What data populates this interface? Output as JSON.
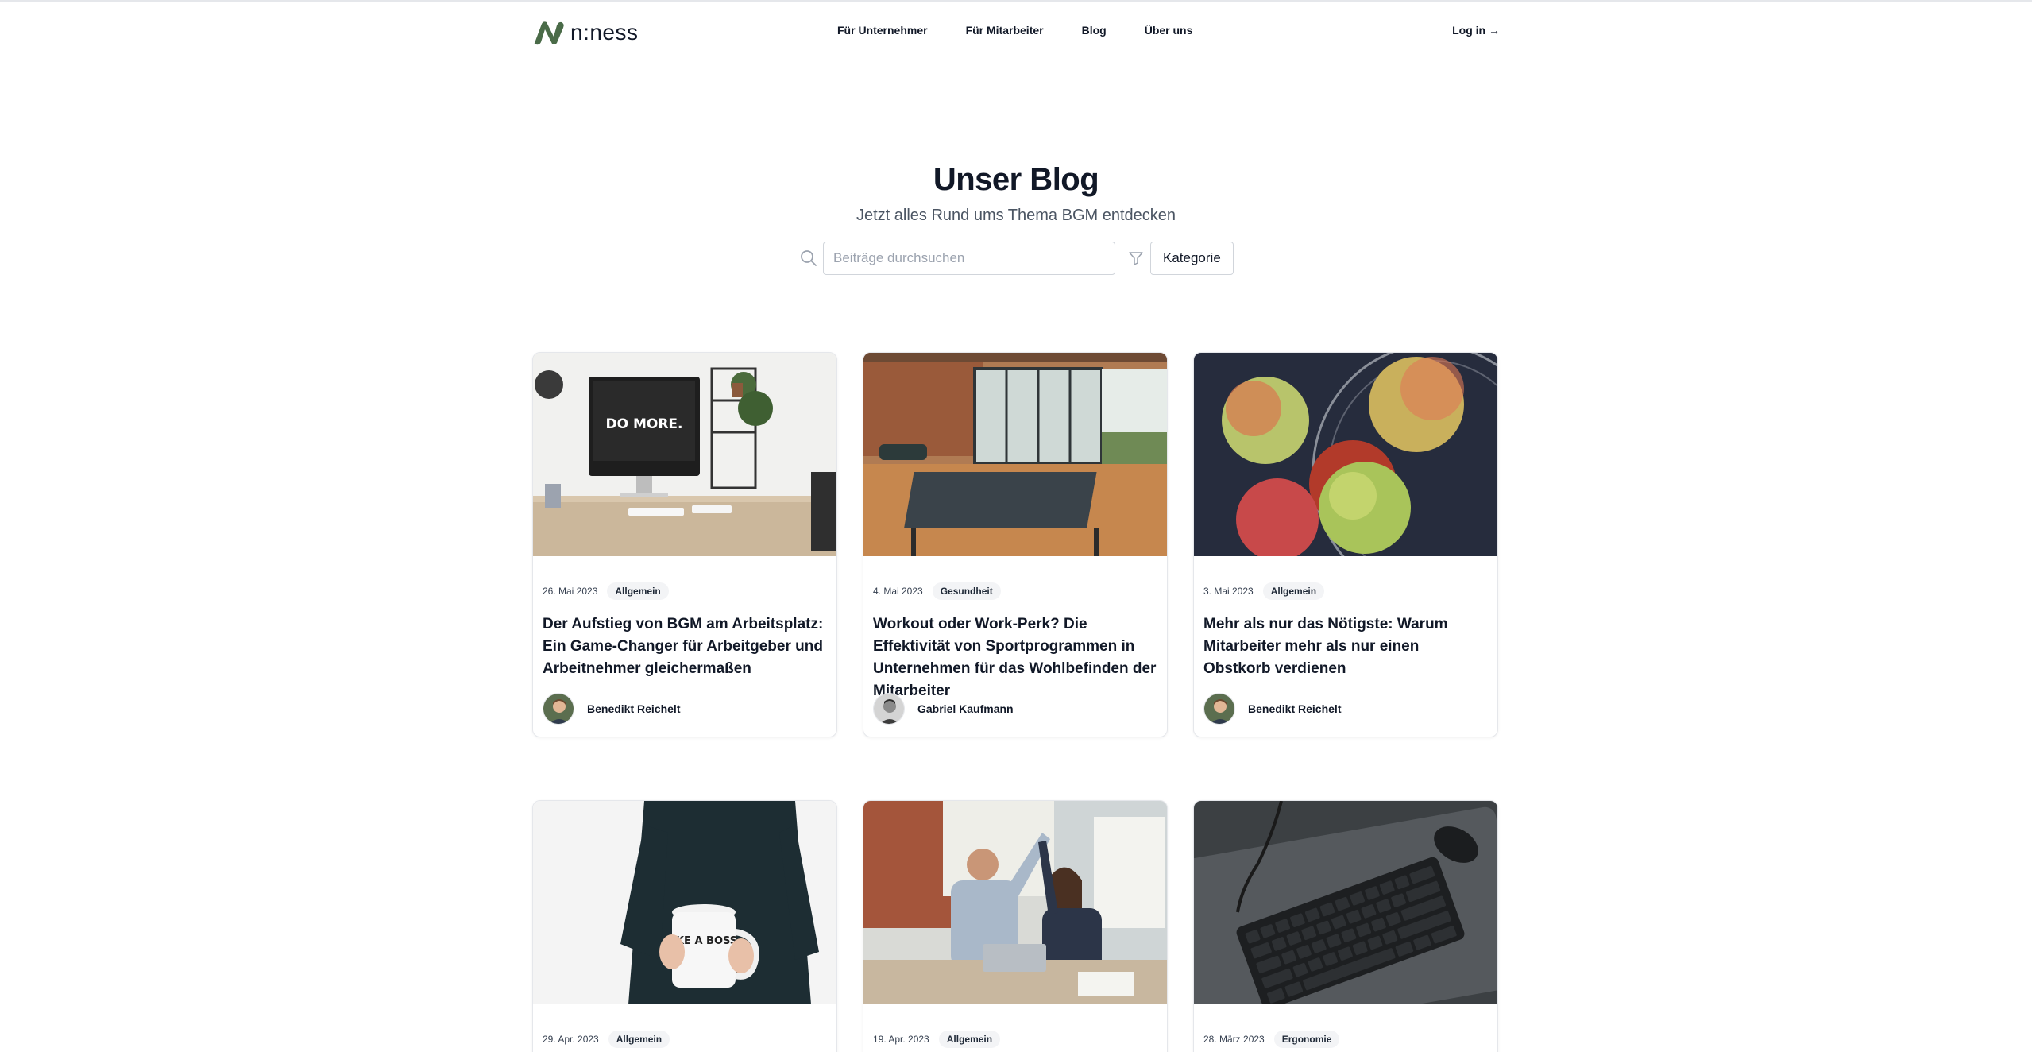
{
  "header": {
    "logo_text": "n:ness",
    "nav": [
      "Für Unternehmer",
      "Für Mitarbeiter",
      "Blog",
      "Über uns"
    ],
    "login": "Log in →"
  },
  "hero": {
    "title": "Unser Blog",
    "subtitle": "Jetzt alles Rund ums Thema BGM entdecken",
    "search_placeholder": "Beiträge durchsuchen",
    "category_button": "Kategorie"
  },
  "posts": [
    {
      "date": "26. Mai 2023",
      "category": "Allgemein",
      "title": "Der Aufstieg von BGM am Arbeitsplatz: Ein Game-Changer für Arbeitgeber und Arbeitnehmer gleichermaßen",
      "author": "Benedikt Reichelt",
      "image_text": "DO MORE."
    },
    {
      "date": "4. Mai 2023",
      "category": "Gesundheit",
      "title": "Workout oder Work-Perk? Die Effektivität von Sportprogrammen in Unternehmen für das Wohlbefinden der Mitarbeiter",
      "author": "Gabriel Kaufmann"
    },
    {
      "date": "3. Mai 2023",
      "category": "Allgemein",
      "title": "Mehr als nur das Nötigste: Warum Mitarbeiter mehr als nur einen Obstkorb verdienen",
      "author": "Benedikt Reichelt"
    },
    {
      "date": "29. Apr. 2023",
      "category": "Allgemein",
      "image_text": "LIKE A BOSS"
    },
    {
      "date": "19. Apr. 2023",
      "category": "Allgemein"
    },
    {
      "date": "28. März 2023",
      "category": "Ergonomie"
    }
  ]
}
